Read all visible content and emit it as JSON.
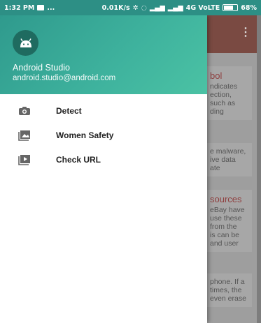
{
  "status_bar": {
    "time": "1:32 PM",
    "dots": "...",
    "speed": "0.01K/s",
    "network": "4G VoLTE",
    "battery": "68%"
  },
  "drawer": {
    "header": {
      "name": "Android Studio",
      "email": "android.studio@android.com",
      "avatar_icon": "android-icon"
    },
    "items": [
      {
        "label": "Detect",
        "icon": "camera-icon"
      },
      {
        "label": "Women Safety",
        "icon": "gallery-icon"
      },
      {
        "label": "Check URL",
        "icon": "video-icon"
      }
    ]
  },
  "background": {
    "menu_glyph": "⋮",
    "cards": [
      {
        "title": "bol",
        "lines": [
          "ndicates",
          "ection,",
          "such as",
          "ding"
        ]
      },
      {
        "title": "",
        "lines": [
          "e malware,",
          "ive data",
          "ate"
        ]
      },
      {
        "title": "sources",
        "lines": [
          "eBay have",
          "use these",
          "from the",
          "is can be",
          "and user"
        ]
      },
      {
        "title": "",
        "lines": [
          "phone. If a",
          "times, the",
          "even erase"
        ]
      }
    ]
  },
  "colors": {
    "status_bar": "#2d8f85",
    "header_start": "#2f9a8d",
    "header_end": "#4bc2a4",
    "bg_toolbar": "#7a4a42"
  }
}
